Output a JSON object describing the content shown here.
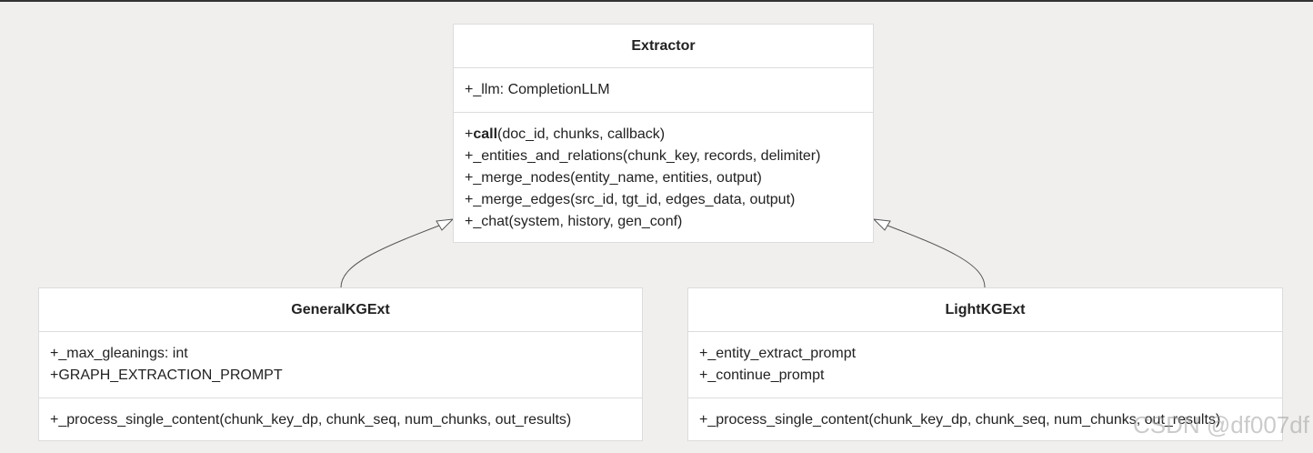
{
  "classes": {
    "extractor": {
      "name": "Extractor",
      "attributes": [
        "+_llm: CompletionLLM"
      ],
      "methods": [
        {
          "prefix": "+",
          "bold": "call",
          "rest": "(doc_id, chunks, callback)"
        },
        {
          "prefix": "",
          "bold": "",
          "rest": "+_entities_and_relations(chunk_key, records, delimiter)"
        },
        {
          "prefix": "",
          "bold": "",
          "rest": "+_merge_nodes(entity_name, entities, output)"
        },
        {
          "prefix": "",
          "bold": "",
          "rest": "+_merge_edges(src_id, tgt_id, edges_data, output)"
        },
        {
          "prefix": "",
          "bold": "",
          "rest": "+_chat(system, history, gen_conf)"
        }
      ]
    },
    "general": {
      "name": "GeneralKGExt",
      "attributes": [
        "+_max_gleanings: int",
        "+GRAPH_EXTRACTION_PROMPT"
      ],
      "methods": [
        "+_process_single_content(chunk_key_dp, chunk_seq, num_chunks, out_results)"
      ]
    },
    "light": {
      "name": "LightKGExt",
      "attributes": [
        "+_entity_extract_prompt",
        "+_continue_prompt"
      ],
      "methods": [
        "+_process_single_content(chunk_key_dp, chunk_seq, num_chunks, out_results)"
      ]
    }
  },
  "relations": [
    {
      "from": "GeneralKGExt",
      "to": "Extractor",
      "type": "inheritance"
    },
    {
      "from": "LightKGExt",
      "to": "Extractor",
      "type": "inheritance"
    }
  ],
  "watermark": "CSDN @df007df"
}
